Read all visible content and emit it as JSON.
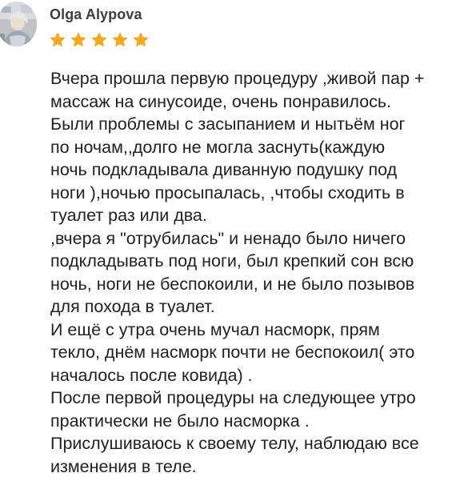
{
  "review": {
    "author_name": "Olga Alypova",
    "rating": 5,
    "rating_max": 5,
    "star_color": "#f4a71f",
    "star_icon": "star-icon",
    "avatar_icon": "user-avatar-photo",
    "text_lines": [
      "Вчера прошла первую процедуру ,живой пар +",
      "массаж на синусоиде, очень понравилось.",
      "Были проблемы с засыпанием и нытьём ног",
      "по ночам,,долго не могла заснуть(каждую",
      "ночь подкладывала диванную подушку под",
      "ноги ),ночью просыпалась, ,чтобы сходить в",
      "туалет раз или два.",
      ",вчера я \"отрубилась\" и ненадо было ничего",
      "подкладывать под ноги, был крепкий сон всю",
      "ночь, ноги не беспокоили, и не было позывов",
      "для похода в туалет.",
      "И ещё с утра очень мучал насморк, прям",
      "текло, днём насморк почти не беспокоил( это",
      "началось после ковида) .",
      "После первой процедуры на следующее утро",
      "практически не было насморка .",
      "Прислушиваюсь к своему телу, наблюдаю все",
      "изменения в теле."
    ]
  }
}
